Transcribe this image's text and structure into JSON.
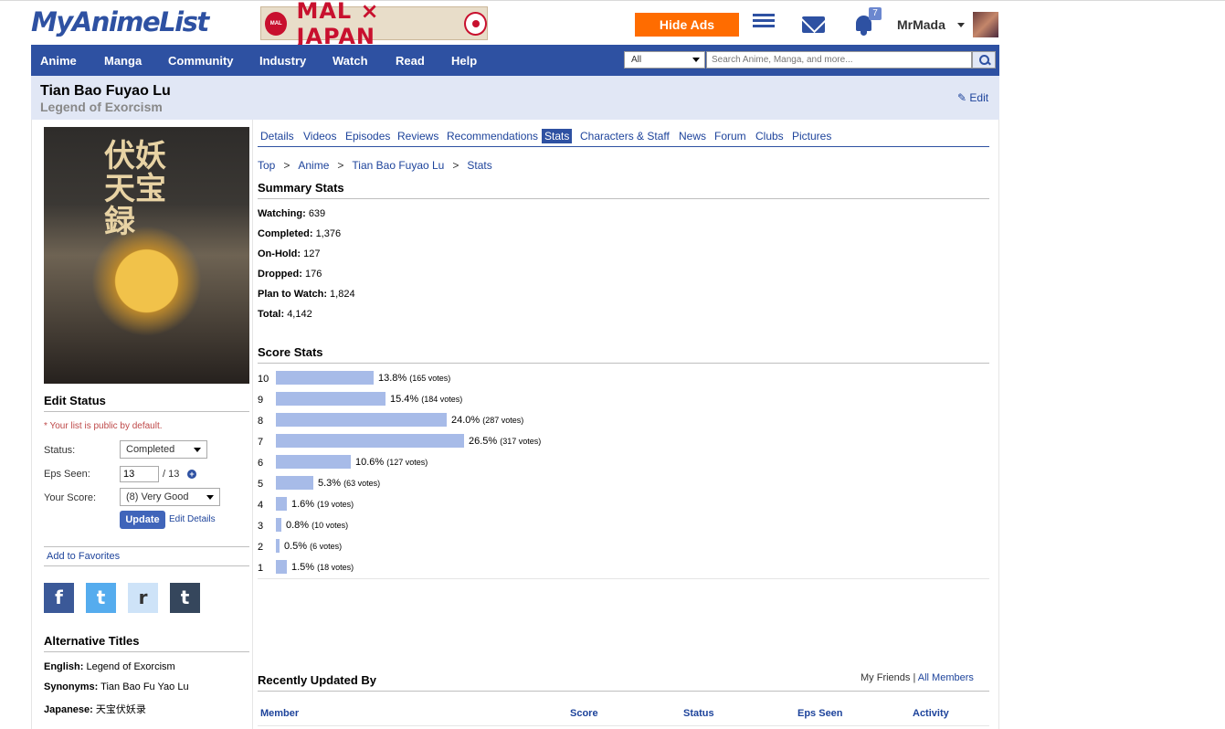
{
  "header": {
    "logo": "MyAnimeList",
    "banner": {
      "left_text": "MAL",
      "x": "×",
      "right_text": "JAPAN"
    },
    "hide_ads": "Hide Ads",
    "notification_count": "7",
    "username": "MrMada"
  },
  "nav": {
    "items": [
      "Anime",
      "Manga",
      "Community",
      "Industry",
      "Watch",
      "Read",
      "Help"
    ],
    "search_category": "All",
    "search_placeholder": "Search Anime, Manga, and more..."
  },
  "title": {
    "main": "Tian Bao Fuyao Lu",
    "english": "Legend of Exorcism",
    "edit": "Edit"
  },
  "cover": {
    "calligraphy": "伏妖天宝録"
  },
  "edit_status": {
    "title": "Edit Status",
    "note": "* Your list is public by default.",
    "status_label": "Status:",
    "status_value": "Completed",
    "eps_label": "Eps Seen:",
    "eps_value": "13",
    "eps_total": "/ 13",
    "score_label": "Your Score:",
    "score_value": "(8) Very Good",
    "update": "Update",
    "edit_details": "Edit Details",
    "add_favorites": "Add to Favorites"
  },
  "social": {
    "facebook": "f",
    "twitter": "t",
    "reddit": "r",
    "tumblr": "t"
  },
  "alt_titles": {
    "title": "Alternative Titles",
    "english_label": "English:",
    "english": "Legend of Exorcism",
    "synonyms_label": "Synonyms:",
    "synonyms": "Tian Bao Fu Yao Lu",
    "japanese_label": "Japanese:",
    "japanese": "天宝伏妖录"
  },
  "tabs": [
    "Details",
    "Videos",
    "Episodes",
    "Reviews",
    "Recommendations",
    "Stats",
    "Characters & Staff",
    "News",
    "Forum",
    "Clubs",
    "Pictures"
  ],
  "active_tab": "Stats",
  "breadcrumb": [
    "Top",
    "Anime",
    "Tian Bao Fuyao Lu",
    "Stats"
  ],
  "summary": {
    "title": "Summary Stats",
    "items": [
      {
        "label": "Watching:",
        "value": "639"
      },
      {
        "label": "Completed:",
        "value": "1,376"
      },
      {
        "label": "On-Hold:",
        "value": "127"
      },
      {
        "label": "Dropped:",
        "value": "176"
      },
      {
        "label": "Plan to Watch:",
        "value": "1,824"
      },
      {
        "label": "Total:",
        "value": "4,142"
      }
    ]
  },
  "score_stats": {
    "title": "Score Stats",
    "rows": [
      {
        "score": "10",
        "pct": 13.8,
        "pct_text": "13.8%",
        "votes": "(165 votes)"
      },
      {
        "score": "9",
        "pct": 15.4,
        "pct_text": "15.4%",
        "votes": "(184 votes)"
      },
      {
        "score": "8",
        "pct": 24.0,
        "pct_text": "24.0%",
        "votes": "(287 votes)"
      },
      {
        "score": "7",
        "pct": 26.5,
        "pct_text": "26.5%",
        "votes": "(317 votes)"
      },
      {
        "score": "6",
        "pct": 10.6,
        "pct_text": "10.6%",
        "votes": "(127 votes)"
      },
      {
        "score": "5",
        "pct": 5.3,
        "pct_text": "5.3%",
        "votes": "(63 votes)"
      },
      {
        "score": "4",
        "pct": 1.6,
        "pct_text": "1.6%",
        "votes": "(19 votes)"
      },
      {
        "score": "3",
        "pct": 0.8,
        "pct_text": "0.8%",
        "votes": "(10 votes)"
      },
      {
        "score": "2",
        "pct": 0.5,
        "pct_text": "0.5%",
        "votes": "(6 votes)"
      },
      {
        "score": "1",
        "pct": 1.5,
        "pct_text": "1.5%",
        "votes": "(18 votes)"
      }
    ]
  },
  "recent": {
    "title": "Recently Updated By",
    "my_friends": "My Friends",
    "divider": "|",
    "all_members": "All Members",
    "columns": [
      "Member",
      "Score",
      "Status",
      "Eps Seen",
      "Activity"
    ]
  },
  "colors": {
    "brand": "#2e51a2",
    "accent": "#ff6c00",
    "bar": "#a7bbe8",
    "titlebar": "#e1e7f5"
  }
}
